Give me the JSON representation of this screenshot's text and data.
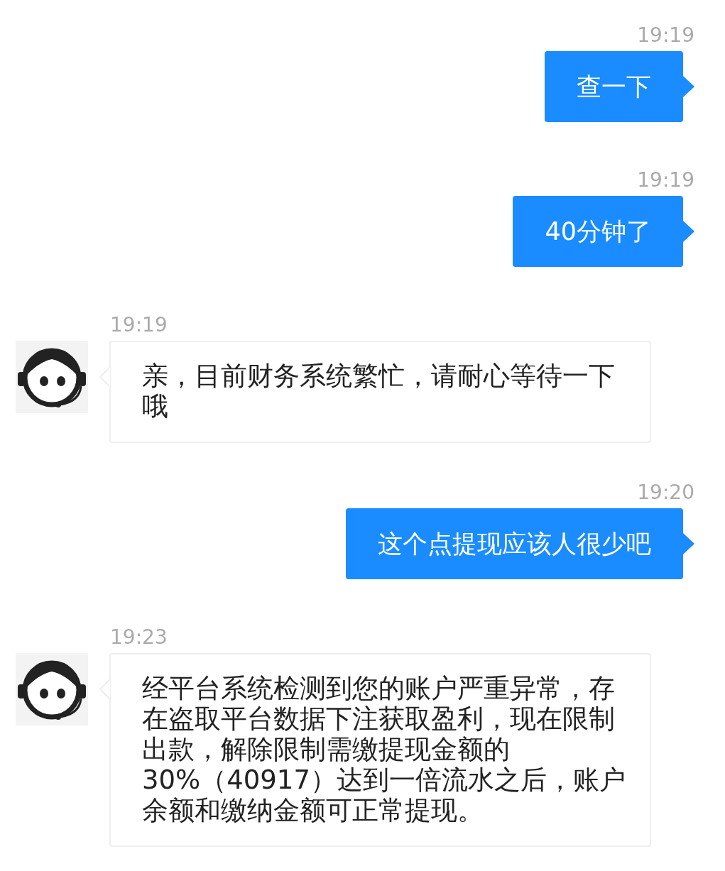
{
  "messages": [
    {
      "kind": "sent",
      "time": "19:19",
      "text": "查一下"
    },
    {
      "kind": "sent",
      "time": "19:19",
      "text": "40分钟了"
    },
    {
      "kind": "received",
      "time": "19:19",
      "text": "亲，目前财务系统繁忙，请耐心等待一下哦"
    },
    {
      "kind": "sent",
      "time": "19:20",
      "text": "这个点提现应该人很少吧"
    },
    {
      "kind": "received",
      "time": "19:23",
      "text": "经平台系统检测到您的账户严重异常，存在盗取平台数据下注获取盈利，现在限制出款，解除限制需缴提现金额的30%（40917）达到一倍流水之后，账户余额和缴纳金额可正常提现。"
    }
  ]
}
